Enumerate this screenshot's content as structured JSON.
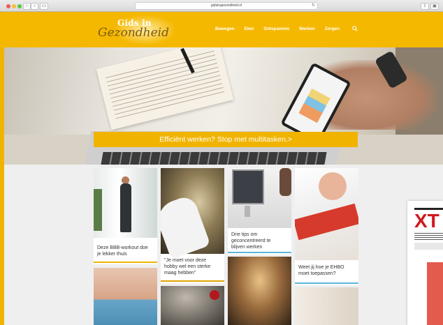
{
  "browser": {
    "url": "gidsingezondheid.nl",
    "back_icon": "chevron-left-icon",
    "forward_icon": "chevron-right-icon"
  },
  "site": {
    "logo_line1": "Gids in",
    "logo_line2": "Gezondheid",
    "brand_color": "#f5b800",
    "nav": [
      "Bewegen",
      "Eten",
      "Ontspannen",
      "Werken",
      "Zorgen"
    ]
  },
  "hero": {
    "banner_text": "Efficiënt werken? Stop met multitasken.>"
  },
  "articles": [
    {
      "title_lines": [
        "Deze BBB-workout doe",
        "je lekker thuis"
      ]
    },
    {
      "title_lines": [
        "\"Je moet voor deze",
        "hobby wel een sterke",
        "maag hebben\""
      ]
    },
    {
      "title_lines": [
        "Drie tips om",
        "geconcentreerd te",
        "blijven werken"
      ]
    },
    {
      "title_lines": [
        "Weet jij hoe je EHBO",
        "moet toepassen?"
      ]
    }
  ],
  "ad": {
    "title": "XT"
  }
}
